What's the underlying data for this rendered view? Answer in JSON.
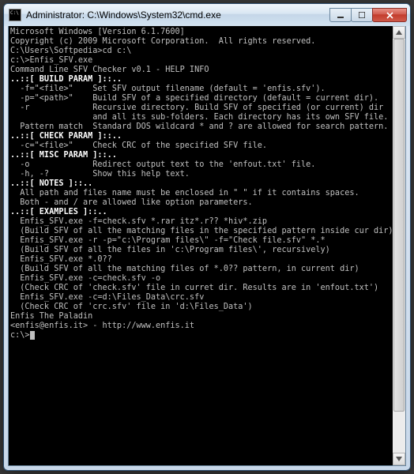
{
  "window": {
    "title": "Administrator: C:\\Windows\\System32\\cmd.exe"
  },
  "console": {
    "lines": [
      {
        "t": "Microsoft Windows [Version 6.1.7600]"
      },
      {
        "t": "Copyright (c) 2009 Microsoft Corporation.  All rights reserved."
      },
      {
        "t": ""
      },
      {
        "t": ""
      },
      {
        "t": "C:\\Users\\Softpedia>cd c:\\"
      },
      {
        "t": ""
      },
      {
        "t": "c:\\>Enfis_SFV.exe"
      },
      {
        "t": "Command Line SFV Checker v0.1 - HELP INFO"
      },
      {
        "t": ""
      },
      {
        "t": ""
      },
      {
        "t": "..::[ BUILD PARAM ]::..",
        "c": "b"
      },
      {
        "t": ""
      },
      {
        "t": "  -f=\"<file>\"    Set SFV output filename (default = 'enfis.sfv')."
      },
      {
        "t": "  -p=\"<path>\"    Build SFV of a specified directory (default = current dir)."
      },
      {
        "t": "  -r             Recursive directory. Build SFV of specified (or current) dir"
      },
      {
        "t": "                 and all its sub-folders. Each directory has its own SFV file."
      },
      {
        "t": "  Pattern match  Standard DOS wildcard * and ? are allowed for search pattern."
      },
      {
        "t": ""
      },
      {
        "t": ""
      },
      {
        "t": "..::[ CHECK PARAM ]::..",
        "c": "b"
      },
      {
        "t": ""
      },
      {
        "t": "  -c=\"<file>\"    Check CRC of the specified SFV file."
      },
      {
        "t": ""
      },
      {
        "t": ""
      },
      {
        "t": "..::[ MISC PARAM ]::..",
        "c": "b"
      },
      {
        "t": ""
      },
      {
        "t": "  -o             Redirect output text to the 'enfout.txt' file."
      },
      {
        "t": "  -h, -?         Show this help text."
      },
      {
        "t": ""
      },
      {
        "t": ""
      },
      {
        "t": "..::[ NOTES ]::..",
        "c": "b"
      },
      {
        "t": ""
      },
      {
        "t": "  All path and files name must be enclosed in \" \" if it contains spaces."
      },
      {
        "t": "  Both - and / are allowed like option parameters."
      },
      {
        "t": ""
      },
      {
        "t": ""
      },
      {
        "t": "..::[ EXAMPLES ]::..",
        "c": "b"
      },
      {
        "t": ""
      },
      {
        "t": "  Enfis_SFV.exe -f=check.sfv *.rar itz*.r?? *hiv*.zip"
      },
      {
        "t": "  (Build SFV of all the matching files in the specified pattern inside cur dir)"
      },
      {
        "t": ""
      },
      {
        "t": "  Enfis_SFV.exe -r -p=\"c:\\Program files\\\" -f=\"Check file.sfv\" *.*"
      },
      {
        "t": "  (Build SFV of all the files in 'c:\\Program files\\', recursively)"
      },
      {
        "t": ""
      },
      {
        "t": "  Enfis_SFV.exe *.0??"
      },
      {
        "t": "  (Build SFV of all the matching files of *.0?? pattern, in current dir)"
      },
      {
        "t": ""
      },
      {
        "t": "  Enfis_SFV.exe -c=check.sfv -o"
      },
      {
        "t": "  (Check CRC of 'check.sfv' file in curret dir. Results are in 'enfout.txt')"
      },
      {
        "t": ""
      },
      {
        "t": "  Enfis_SFV.exe -c=d:\\Files_Data\\crc.sfv"
      },
      {
        "t": "  (Check CRC of 'crc.sfv' file in 'd:\\Files_Data')"
      },
      {
        "t": ""
      },
      {
        "t": ""
      },
      {
        "t": "Enfis The Paladin"
      },
      {
        "t": "<enfis@enfis.it> - http://www.enfis.it"
      },
      {
        "t": ""
      },
      {
        "t": "c:\\>",
        "cursor": true
      }
    ]
  }
}
